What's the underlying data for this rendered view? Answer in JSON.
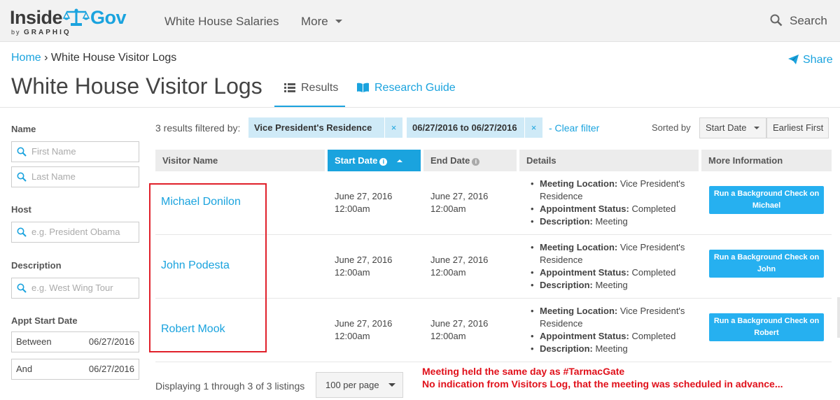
{
  "brand": {
    "name_part1": "Inside",
    "name_part2": "Gov",
    "by": "by",
    "company": "GRAPHIQ",
    "accent_color": "#1aa3de"
  },
  "nav": {
    "salaries": "White House Salaries",
    "more": "More",
    "search": "Search"
  },
  "breadcrumb": {
    "home": "Home",
    "separator": "›",
    "current": "White House Visitor Logs"
  },
  "share": "Share",
  "page_title": "White House Visitor Logs",
  "tabs": {
    "results": "Results",
    "research_guide": "Research Guide"
  },
  "sidebar": {
    "name_label": "Name",
    "first_name_placeholder": "First Name",
    "last_name_placeholder": "Last Name",
    "host_label": "Host",
    "host_placeholder": "e.g. President Obama",
    "description_label": "Description",
    "description_placeholder": "e.g. West Wing Tour",
    "appt_start_label": "Appt Start Date",
    "between_label": "Between",
    "between_value": "06/27/2016",
    "and_label": "And",
    "and_value": "06/27/2016"
  },
  "filters": {
    "count_text": "3 results filtered by:",
    "chip1": "Vice President's Residence",
    "chip2": "06/27/2016 to 06/27/2016",
    "remove": "×",
    "clear": "- Clear filter",
    "sorted_by": "Sorted by",
    "sort_field": "Start Date",
    "sort_order": "Earliest First"
  },
  "table": {
    "headers": {
      "visitor": "Visitor Name",
      "start": "Start Date",
      "end": "End Date",
      "details": "Details",
      "more": "More Information"
    },
    "rows": [
      {
        "name": "Michael Donilon",
        "start_date": "June 27, 2016",
        "start_time": "12:00am",
        "end_date": "June 27, 2016",
        "end_time": "12:00am",
        "loc_label": "Meeting Location:",
        "loc_value": "Vice President's Residence",
        "status_label": "Appointment Status:",
        "status_value": "Completed",
        "desc_label": "Description:",
        "desc_value": "Meeting",
        "button_line1": "Run a Background Check on",
        "button_line2": "Michael"
      },
      {
        "name": "John Podesta",
        "start_date": "June 27, 2016",
        "start_time": "12:00am",
        "end_date": "June 27, 2016",
        "end_time": "12:00am",
        "loc_label": "Meeting Location:",
        "loc_value": "Vice President's Residence",
        "status_label": "Appointment Status:",
        "status_value": "Completed",
        "desc_label": "Description:",
        "desc_value": "Meeting",
        "button_line1": "Run a Background Check on",
        "button_line2": "John"
      },
      {
        "name": "Robert Mook",
        "start_date": "June 27, 2016",
        "start_time": "12:00am",
        "end_date": "June 27, 2016",
        "end_time": "12:00am",
        "loc_label": "Meeting Location:",
        "loc_value": "Vice President's Residence",
        "status_label": "Appointment Status:",
        "status_value": "Completed",
        "desc_label": "Description:",
        "desc_value": "Meeting",
        "button_line1": "Run a Background Check on",
        "button_line2": "Robert"
      }
    ]
  },
  "footer": {
    "displaying": "Displaying 1 through 3 of 3 listings",
    "per_page": "100 per page"
  },
  "annotation": {
    "line1": "Meeting held the same day as #TarmacGate",
    "line2": "No indication from Visitors Log, that the meeting was scheduled in advance...",
    "color": "#e0101a"
  }
}
